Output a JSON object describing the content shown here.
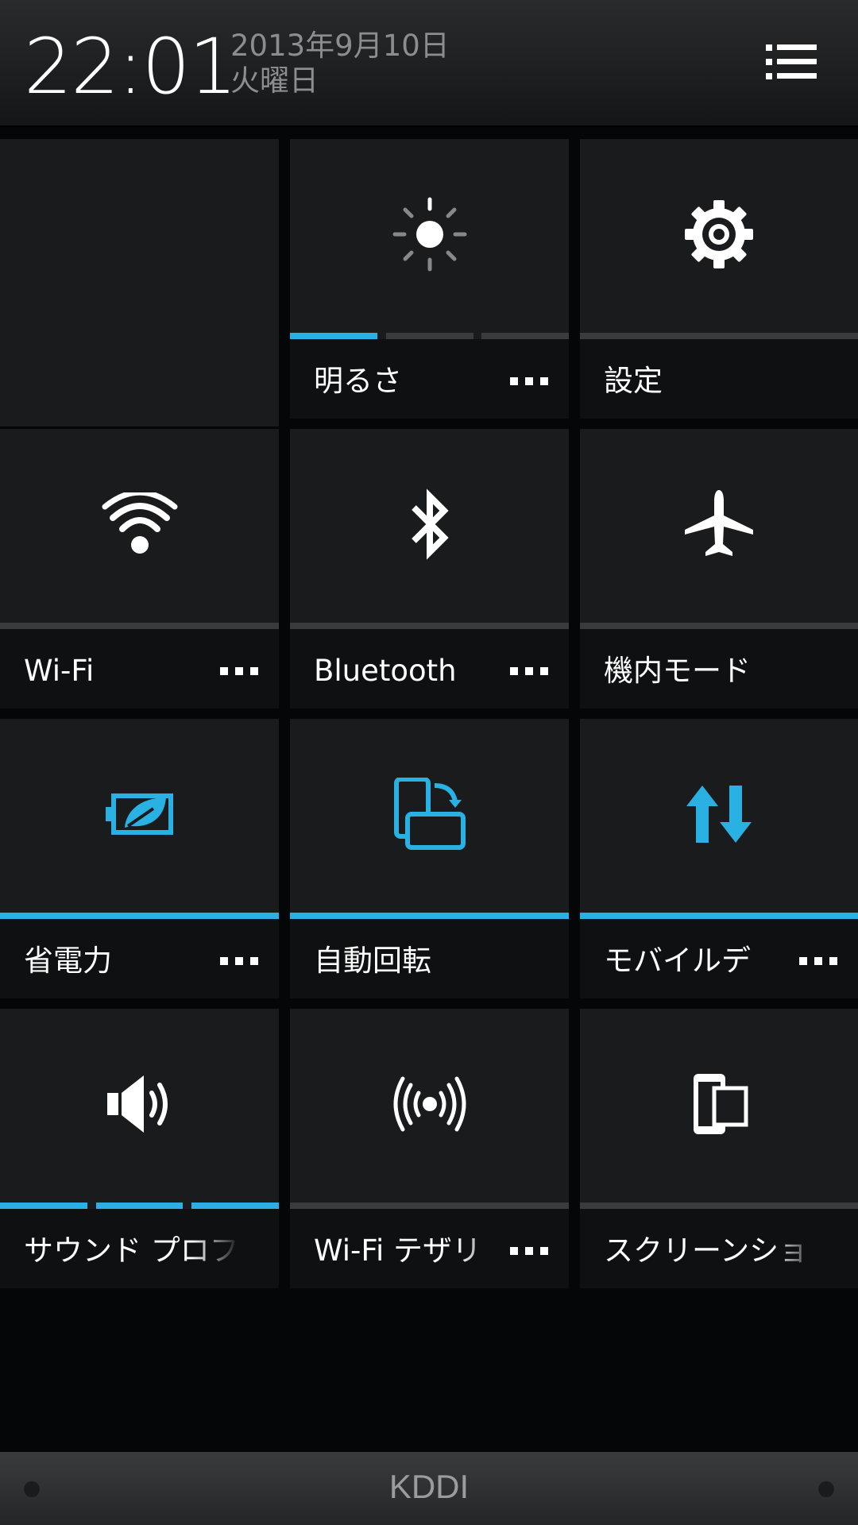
{
  "header": {
    "time": "22:01",
    "date": "2013年9月10日",
    "weekday": "火曜日"
  },
  "tiles": {
    "brightness": {
      "label": "明るさ",
      "icon": "brightness-icon",
      "level_segments": [
        true,
        false,
        false
      ]
    },
    "settings": {
      "label": "設定",
      "icon": "gear-icon"
    },
    "wifi": {
      "label": "Wi-Fi",
      "icon": "wifi-icon",
      "active": false
    },
    "bluetooth": {
      "label": "Bluetooth",
      "icon": "bluetooth-icon",
      "active": false
    },
    "airplane": {
      "label": "機内モード",
      "icon": "airplane-icon",
      "active": false
    },
    "power_saver": {
      "label": "省電力",
      "icon": "battery-leaf-icon",
      "active": true
    },
    "auto_rotate": {
      "label": "自動回転",
      "icon": "rotate-icon",
      "active": true
    },
    "mobile_data": {
      "label": "モバイルデ",
      "icon": "data-arrows-icon",
      "active": true
    },
    "sound_profile": {
      "label": "サウンド プロフ",
      "icon": "speaker-icon",
      "level_segments": [
        true,
        true,
        true
      ]
    },
    "wifi_tethering": {
      "label": "Wi-Fi テザリ",
      "icon": "hotspot-icon",
      "active": false
    },
    "screenshot": {
      "label": "スクリーンショ",
      "icon": "screenshot-icon"
    }
  },
  "colors": {
    "accent": "#2ab1e4",
    "tile": "#1a1b1c",
    "label_bg": "#0f1011",
    "inactive_bar": "#3a3b3d"
  },
  "footer": {
    "carrier": "KDDI"
  }
}
